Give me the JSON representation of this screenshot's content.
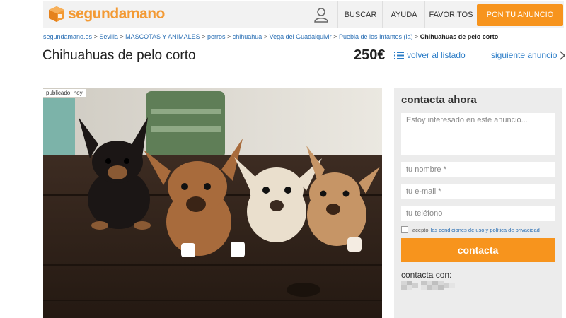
{
  "header": {
    "logo_text": "segundamano",
    "nav": {
      "search": "BUSCAR",
      "help": "AYUDA",
      "favorites": "FAVORITOS",
      "post": "PON TU ANUNCIO"
    },
    "accent_color": "#f7941d"
  },
  "breadcrumb": {
    "items": [
      "segundamano.es",
      "Sevilla",
      "MASCOTAS Y ANIMALES",
      "perros",
      "chihuahua",
      "Vega del Guadalquivir",
      "Puebla de los Infantes (la)"
    ],
    "separator": ">",
    "current": "Chihuahuas de pelo corto"
  },
  "listing": {
    "title": "Chihuahuas de pelo corto",
    "price": "250€",
    "back_label": "volver al listado",
    "next_label": "siguiente anuncio",
    "published_badge": "publicado: hoy"
  },
  "contact": {
    "heading": "contacta ahora",
    "message_placeholder": "Estoy interesado en este anuncio...",
    "name_placeholder": "tu nombre *",
    "email_placeholder": "tu e-mail *",
    "phone_placeholder": "tu teléfono",
    "terms_prefix": "acepto",
    "terms_link": "las condiciones de uso y política de privacidad",
    "submit_label": "contacta",
    "contact_with_label": "contacta con:"
  },
  "icons": [
    "logo-box-icon",
    "user-icon",
    "list-icon",
    "chevron-right-icon"
  ]
}
